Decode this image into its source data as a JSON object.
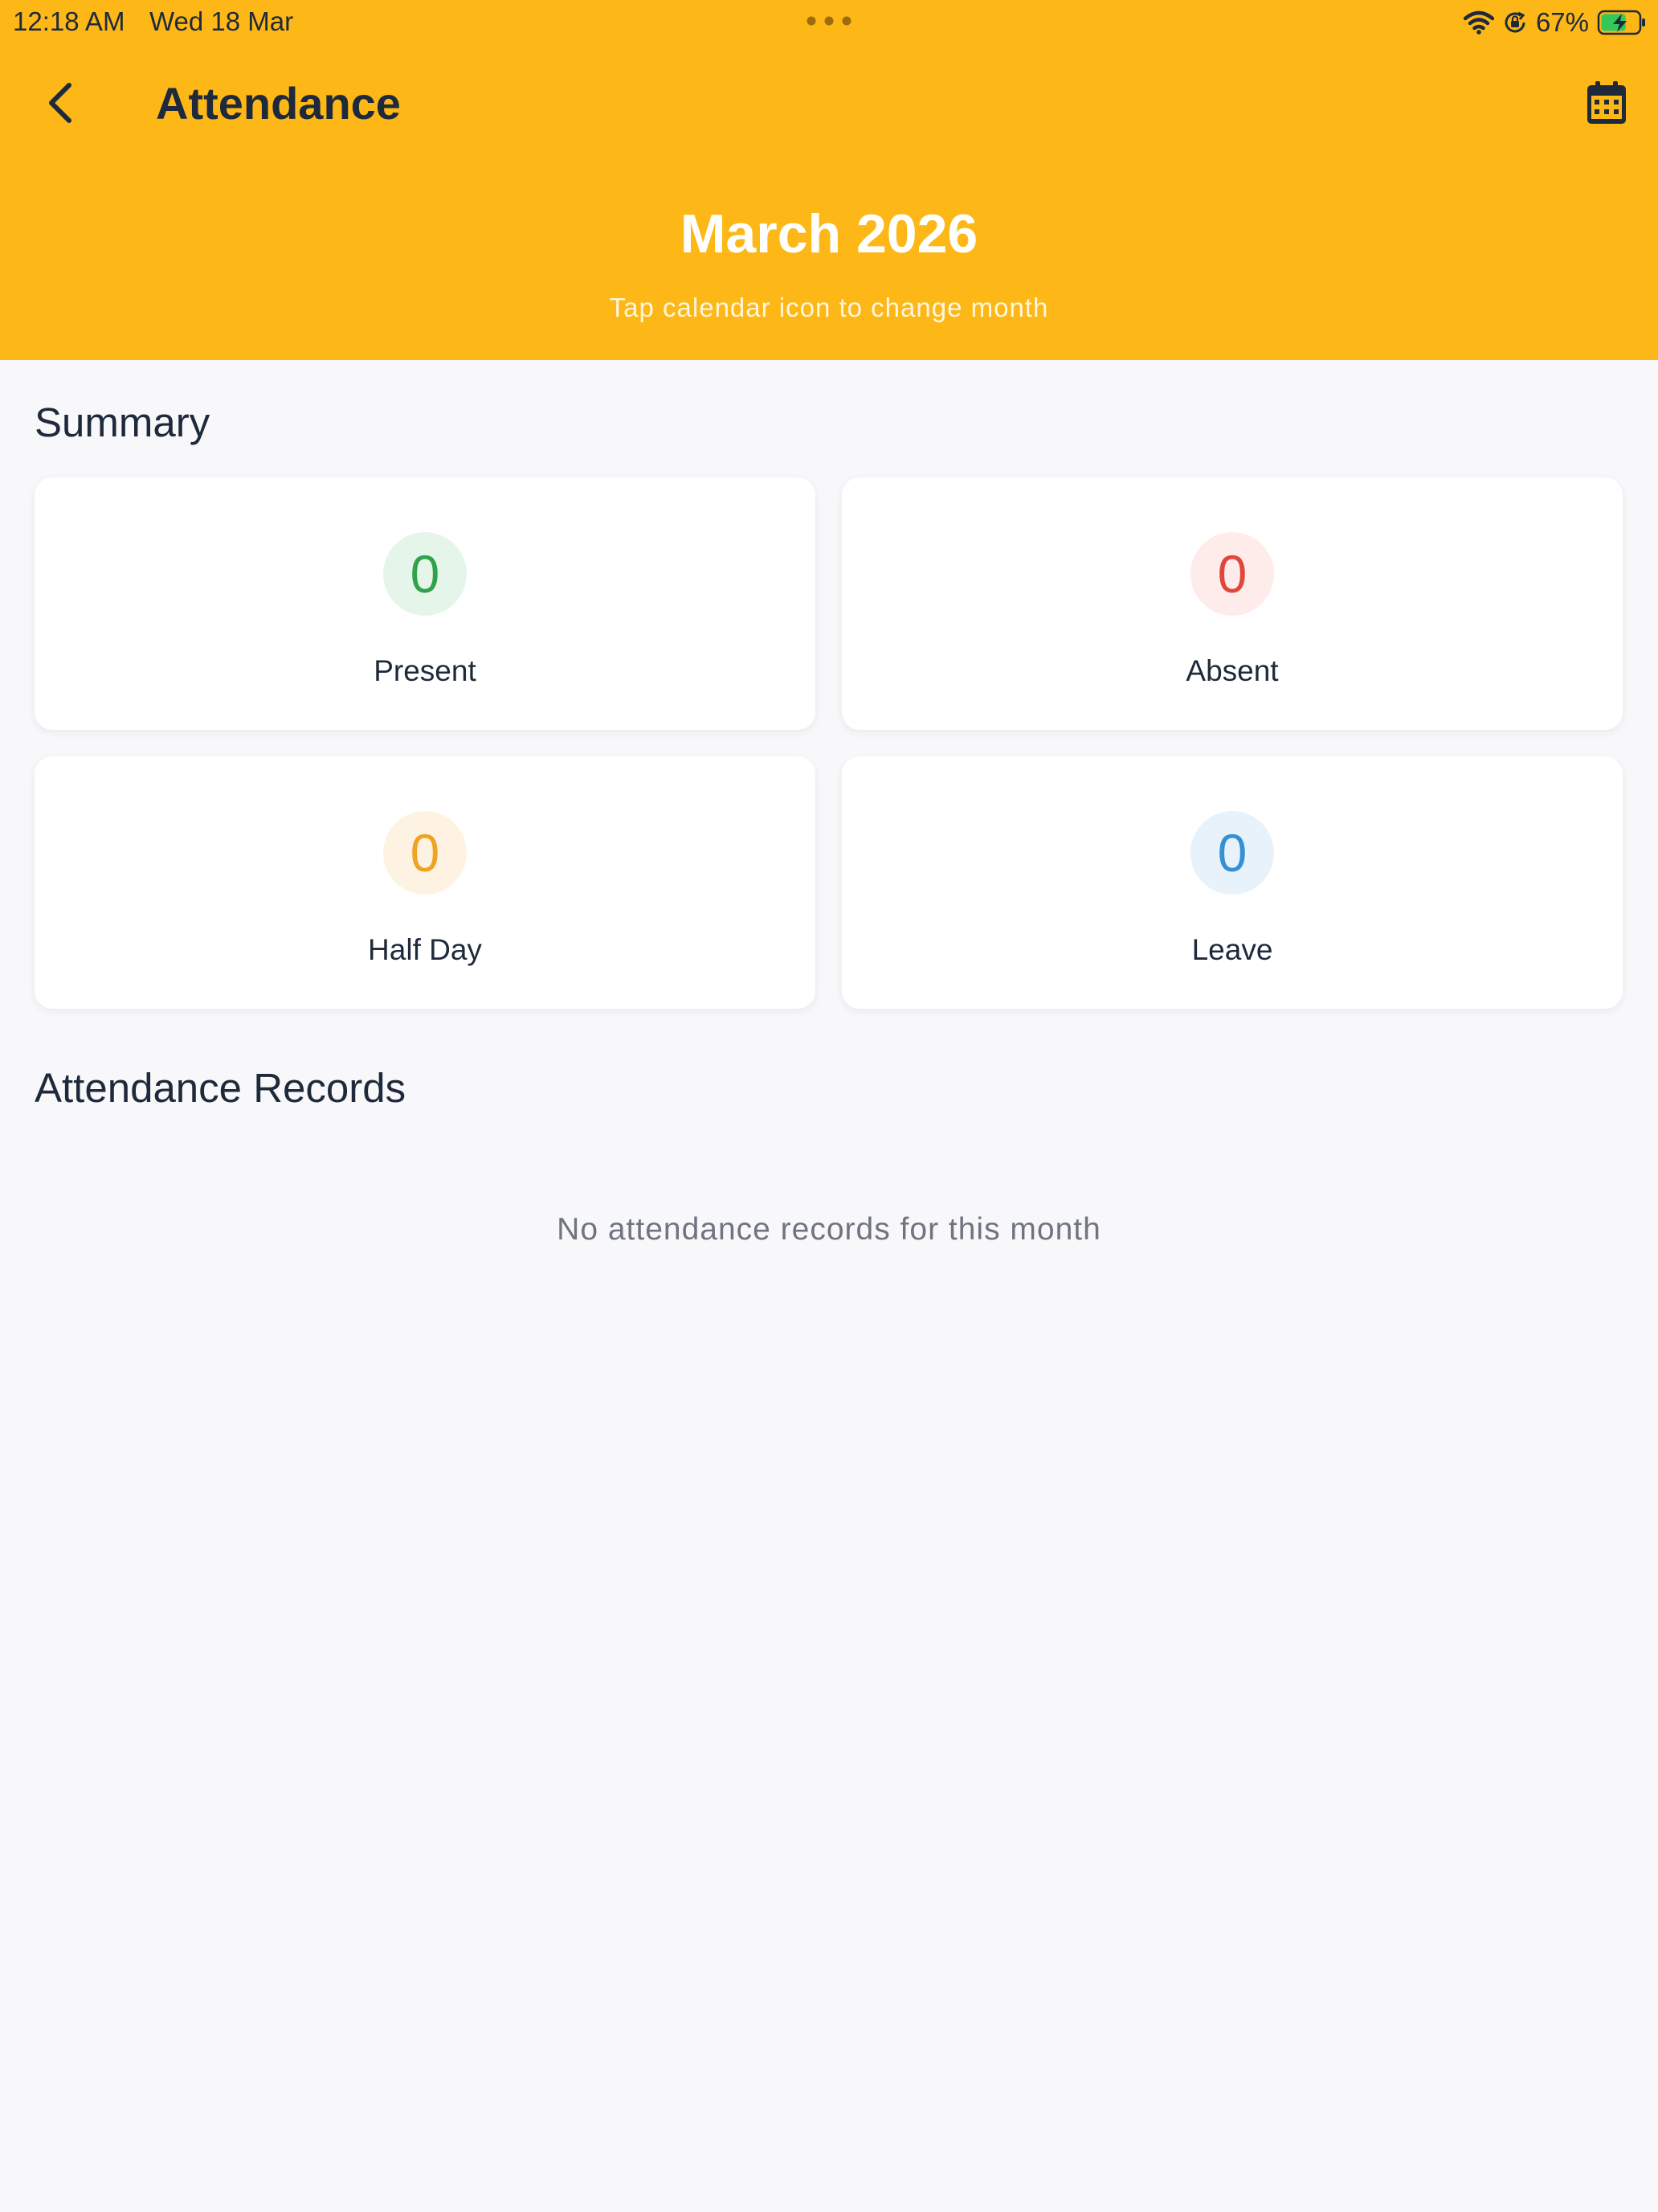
{
  "status_bar": {
    "time": "12:18 AM",
    "date": "Wed 18 Mar",
    "battery_percent": "67%",
    "battery_level": 0.67
  },
  "header": {
    "title": "Attendance",
    "month": "March 2026",
    "hint": "Tap calendar icon to change month",
    "background_color": "#fdb716",
    "back_icon": "chevron-left-icon",
    "calendar_icon": "calendar-icon"
  },
  "summary": {
    "title": "Summary",
    "cards": {
      "present": {
        "count": "0",
        "label": "Present",
        "color": "#2fa34c",
        "bg": "#e6f5ea"
      },
      "absent": {
        "count": "0",
        "label": "Absent",
        "color": "#e0463a",
        "bg": "#fdecea"
      },
      "half_day": {
        "count": "0",
        "label": "Half Day",
        "color": "#f0a223",
        "bg": "#fef3e2"
      },
      "leave": {
        "count": "0",
        "label": "Leave",
        "color": "#3591d3",
        "bg": "#e7f2fb"
      }
    }
  },
  "records": {
    "title": "Attendance Records",
    "empty_message": "No attendance records for this month"
  }
}
